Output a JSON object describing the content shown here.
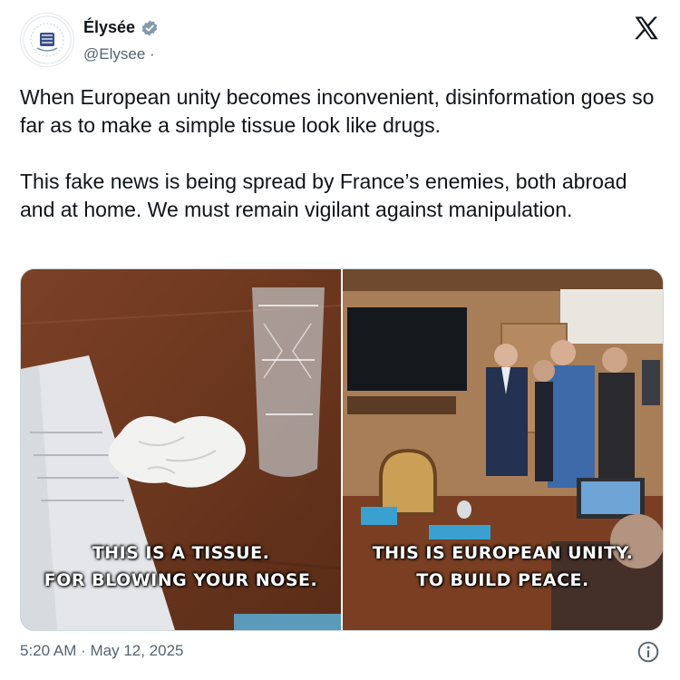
{
  "account": {
    "display_name": "Élysée",
    "handle": "@Elysee ·",
    "avatar_icon": "elysee-seal-icon",
    "verified_color": "#829aab"
  },
  "tweet": {
    "text": "When European unity becomes inconvenient, disinformation goes so far as to make a simple tissue look like drugs.\n\nThis fake news is being spread by France’s enemies, both abroad and at home. We must remain vigilant against manipulation.",
    "timestamp": "5:20 AM · May 12, 2025"
  },
  "media": {
    "left_caption_line1": "THIS IS A TISSUE.",
    "left_caption_line2": "FOR BLOWING YOUR NOSE.",
    "right_caption_line1": "THIS IS EUROPEAN UNITY.",
    "right_caption_line2": "TO BUILD PEACE."
  },
  "icons": {
    "platform": "x-logo-icon",
    "info": "info-icon"
  }
}
